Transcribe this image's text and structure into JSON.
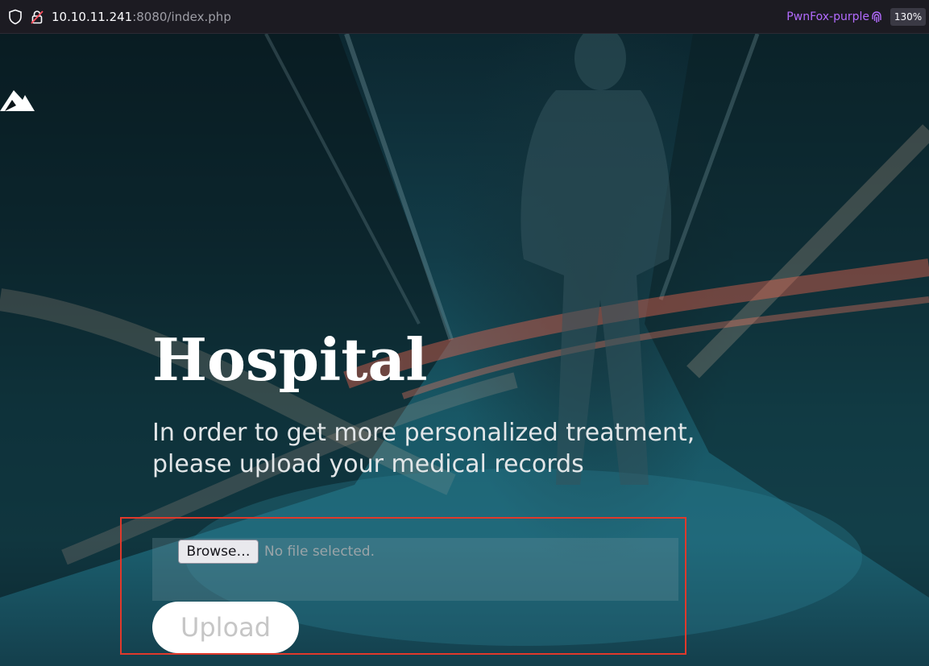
{
  "browser": {
    "url_host": "10.10.11.241",
    "url_rest": ":8080/index.php",
    "container_label": "PwnFox-purple",
    "zoom": "130%",
    "icons": [
      "shield-icon",
      "lock-icon",
      "fingerprint-icon"
    ]
  },
  "hero": {
    "title": "Hospital",
    "subtitle": "In order to get more personalized treatment, please upload your medical records"
  },
  "upload_form": {
    "browse_label": "Browse…",
    "file_status": "No file selected.",
    "upload_label": "Upload",
    "highlight_color": "#e0392b"
  },
  "colors": {
    "container_accent": "#b36bff",
    "title_text": "#ffffff"
  }
}
